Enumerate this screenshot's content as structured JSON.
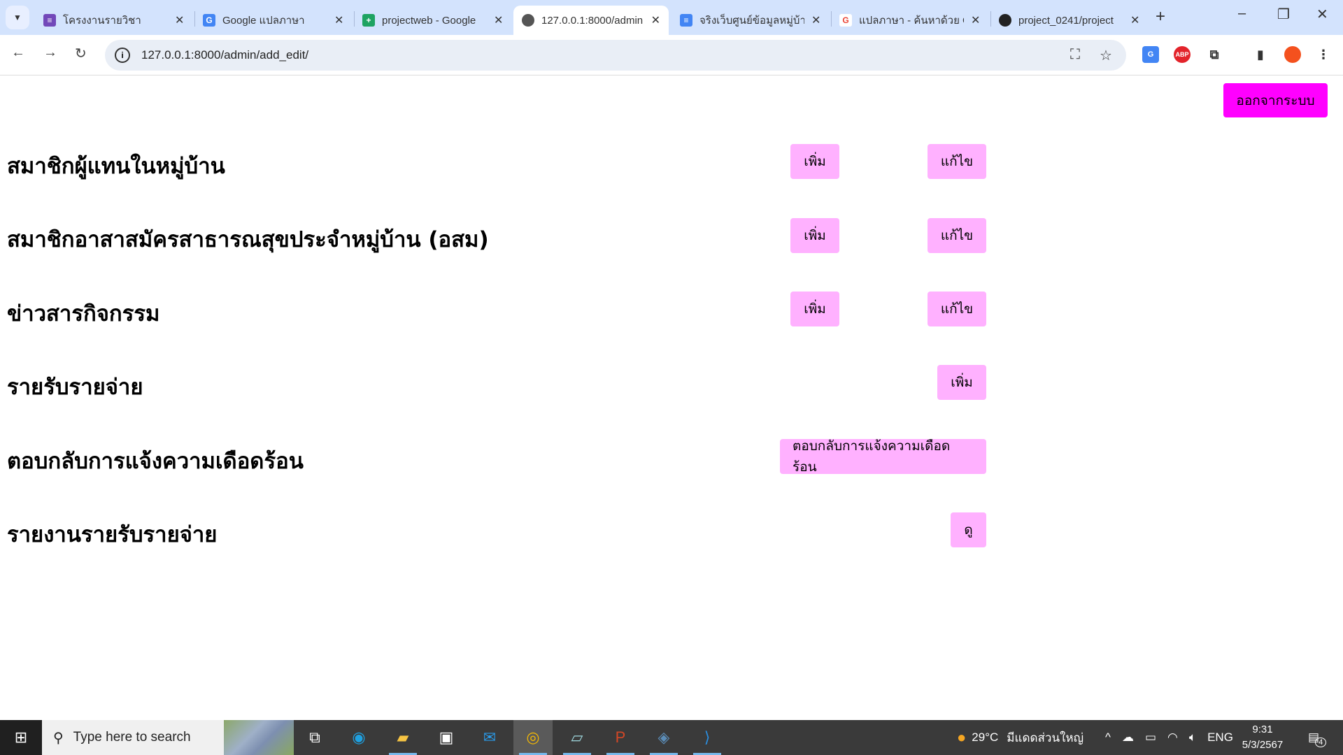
{
  "browser": {
    "tabs": [
      {
        "label": "โครงงานรายวิชา",
        "icon": "google-forms-icon",
        "color": "#7248b9"
      },
      {
        "label": "Google แปลภาษา",
        "icon": "google-translate-icon",
        "color": "#4285f4"
      },
      {
        "label": "projectweb - Google",
        "icon": "google-sheets-icon",
        "color": "#1ea362"
      },
      {
        "label": "127.0.0.1:8000/admin",
        "icon": "globe-icon",
        "color": "#555555"
      },
      {
        "label": "จริงเว็บศูนย์ข้อมูลหมู่บ้าน",
        "icon": "google-docs-icon",
        "color": "#4285f4"
      },
      {
        "label": "แปลภาษา - ค้นหาด้วย G",
        "icon": "google-icon",
        "color": "#ea4335"
      },
      {
        "label": "project_0241/project",
        "icon": "github-icon",
        "color": "#222222"
      }
    ],
    "url": "127.0.0.1:8000/admin/add_edit/"
  },
  "page": {
    "logout_label": "ออกจากระบบ",
    "rows": [
      {
        "title": "สมาชิกผู้แทนในหมู่บ้าน",
        "add": "เพิ่ม",
        "edit": "แก้ไข"
      },
      {
        "title": "สมาชิกอาสาสมัครสาธารณสุขประจำหมู่บ้าน (อสม)",
        "add": "เพิ่ม",
        "edit": "แก้ไข"
      },
      {
        "title": "ข่าวสารกิจกรรม",
        "add": "เพิ่ม",
        "edit": "แก้ไข"
      },
      {
        "title": "รายรับรายจ่าย",
        "add": "เพิ่ม"
      },
      {
        "title": "ตอบกลับการแจ้งความเดือดร้อน",
        "action": "ตอบกลับการแจ้งความเดือดร้อน"
      },
      {
        "title": "รายงานรายรับรายจ่าย",
        "action": "ดู"
      }
    ],
    "colors": {
      "button": "#ffb1ff",
      "logout": "#ff00ff"
    }
  },
  "taskbar": {
    "search_placeholder": "Type here to search",
    "weather": "29°C",
    "weather_desc": "มีแดดส่วนใหญ่",
    "language": "ENG",
    "time": "9:31",
    "date": "5/3/2567",
    "notifications": "4"
  }
}
